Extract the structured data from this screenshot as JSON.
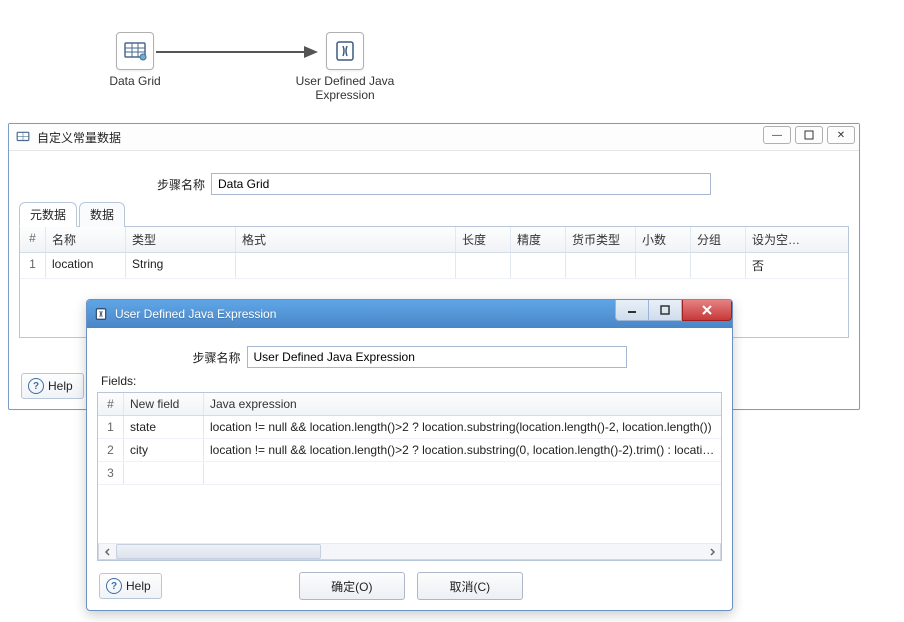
{
  "canvas": {
    "nodes": [
      {
        "label": "Data Grid",
        "icon": "data-grid-icon"
      },
      {
        "label": "User Defined Java Expression",
        "icon": "java-expression-icon"
      }
    ]
  },
  "window1": {
    "title": "自定义常量数据",
    "step_label": "步骤名称",
    "step_value": "Data Grid",
    "tabs": [
      "元数据",
      "数据"
    ],
    "columns": {
      "rownum": "#",
      "name": "名称",
      "type": "类型",
      "format": "格式",
      "length": "长度",
      "precision": "精度",
      "currency": "货币类型",
      "decimal": "小数",
      "group": "分组",
      "nullable": "设为空串?"
    },
    "rows": [
      {
        "num": "1",
        "name": "location",
        "type": "String",
        "format": "",
        "length": "",
        "precision": "",
        "currency": "",
        "decimal": "",
        "group": "",
        "nullable": "否"
      }
    ],
    "help": "Help"
  },
  "window2": {
    "title": "User Defined Java Expression",
    "step_label": "步骤名称",
    "step_value": "User Defined Java Expression",
    "fields_label": "Fields:",
    "columns": {
      "rownum": "#",
      "newfield": "New field",
      "expr": "Java expression"
    },
    "rows": [
      {
        "num": "1",
        "newfield": "state",
        "expr": "location != null && location.length()>2 ? location.substring(location.length()-2, location.length())"
      },
      {
        "num": "2",
        "newfield": "city",
        "expr": "location != null && location.length()>2 ? location.substring(0, location.length()-2).trim() : location"
      },
      {
        "num": "3",
        "newfield": "",
        "expr": ""
      }
    ],
    "help": "Help",
    "ok": "确定(O)",
    "cancel": "取消(C)"
  },
  "win_controls": {
    "minimize": "—",
    "maximize": "□",
    "close": "✕"
  }
}
